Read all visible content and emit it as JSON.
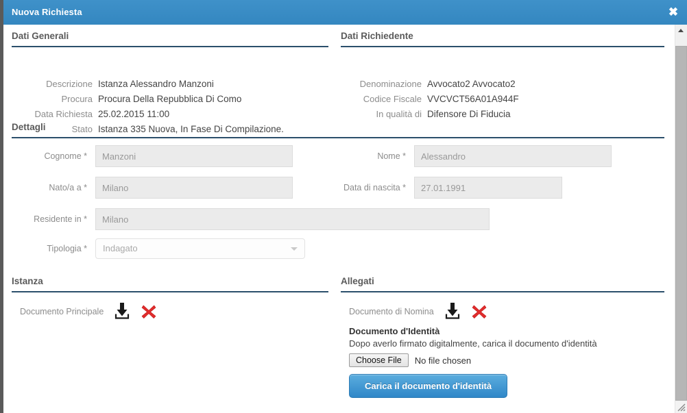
{
  "window": {
    "title": "Nuova Richiesta",
    "close_label": "✖",
    "accent_color": "#3487c0",
    "rule_color": "#2b4f6b"
  },
  "sections": {
    "dati_generali": {
      "title": "Dati Generali",
      "rows": [
        {
          "label": "Descrizione",
          "value": "Istanza Alessandro Manzoni"
        },
        {
          "label": "Procura",
          "value": "Procura Della Repubblica Di Como"
        },
        {
          "label": "Data Richiesta",
          "value": "25.02.2015 11:00"
        },
        {
          "label": "Stato",
          "value": "Istanza 335 Nuova, In Fase Di Compilazione."
        }
      ]
    },
    "dati_richiedente": {
      "title": "Dati Richiedente",
      "rows": [
        {
          "label": "Denominazione",
          "value": "Avvocato2 Avvocato2"
        },
        {
          "label": "Codice Fiscale",
          "value": "VVCVCT56A01A944F"
        },
        {
          "label": "In qualità di",
          "value": "Difensore Di Fiducia"
        }
      ]
    },
    "dettagli": {
      "title": "Dettagli",
      "fields": {
        "cognome": {
          "label": "Cognome *",
          "value": "Manzoni"
        },
        "nome": {
          "label": "Nome *",
          "value": "Alessandro"
        },
        "nato_a": {
          "label": "Nato/a a *",
          "value": "Milano"
        },
        "data_nascita": {
          "label": "Data di nascita *",
          "value": "27.01.1991"
        },
        "residente_in": {
          "label": "Residente in *",
          "value": "Milano"
        },
        "tipologia": {
          "label": "Tipologia *",
          "value": "Indagato"
        }
      }
    },
    "istanza": {
      "title": "Istanza",
      "documento_principale_label": "Documento Principale"
    },
    "allegati": {
      "title": "Allegati",
      "documento_nomina_label": "Documento di Nomina",
      "identity": {
        "title": "Documento d'Identità",
        "instruction": "Dopo averlo firmato digitalmente, carica il documento d'identità",
        "choose_file_label": "Choose File",
        "no_file_label": "No file chosen",
        "upload_button_label": "Carica il documento d'identità"
      }
    }
  }
}
